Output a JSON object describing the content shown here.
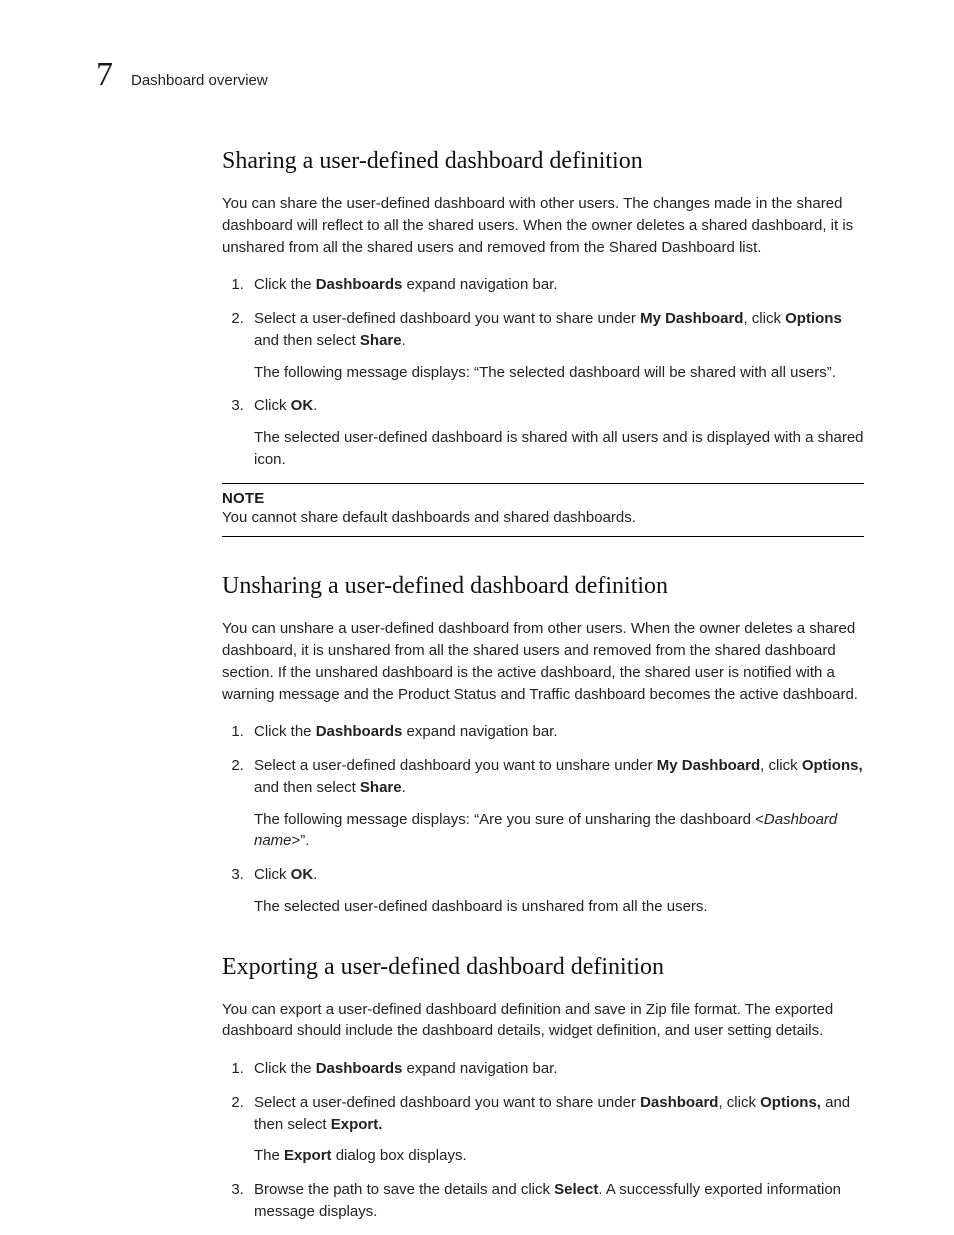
{
  "header": {
    "chapter_num": "7",
    "chapter_title": "Dashboard overview"
  },
  "sections": {
    "sharing": {
      "title": "Sharing a user-defined dashboard definition",
      "intro": "You can share the user-defined dashboard with other users. The changes made in the shared dashboard will reflect to all the shared users. When the owner deletes a shared dashboard, it is unshared from all the shared users and removed from the Shared Dashboard list.",
      "step1_a": "Click the ",
      "step1_b": "Dashboards",
      "step1_c": " expand navigation bar.",
      "step2_a": "Select a user-defined dashboard you want to share under ",
      "step2_b": "My Dashboard",
      "step2_c": ", click ",
      "step2_d": "Options",
      "step2_e": " and then select ",
      "step2_f": "Share",
      "step2_g": ".",
      "step2_sub": "The following message displays: “The selected dashboard will be shared with all users”.",
      "step3_a": "Click ",
      "step3_b": "OK",
      "step3_c": ".",
      "step3_sub": "The selected user-defined dashboard is shared with all users and is displayed with a shared icon.",
      "note_label": "NOTE",
      "note_text": "You cannot share default dashboards and shared dashboards."
    },
    "unsharing": {
      "title": "Unsharing a user-defined dashboard definition",
      "intro": "You can unshare a user-defined dashboard from other users. When the owner deletes a shared dashboard, it is unshared from all the shared users and removed from the shared dashboard section. If the unshared dashboard is the active dashboard, the shared user is notified with a warning message and the Product Status and Traffic dashboard becomes the active dashboard.",
      "step1_a": "Click the ",
      "step1_b": "Dashboards",
      "step1_c": " expand navigation bar.",
      "step2_a": "Select a user-defined dashboard you want to unshare under ",
      "step2_b": "My Dashboard",
      "step2_c": ", click ",
      "step2_d": "Options,",
      "step2_e": " and then select ",
      "step2_f": "Share",
      "step2_g": ".",
      "step2_sub_a": "The following message displays: “Are you sure of unsharing the dashboard <",
      "step2_sub_b": "Dashboard name",
      "step2_sub_c": ">”.",
      "step3_a": "Click ",
      "step3_b": "OK",
      "step3_c": ".",
      "step3_sub": "The selected user-defined dashboard is unshared from all the users."
    },
    "exporting": {
      "title": "Exporting a user-defined dashboard definition",
      "intro": "You can export a user-defined dashboard definition and save in Zip file format. The exported dashboard should include the dashboard details, widget definition, and user setting details.",
      "step1_a": "Click the ",
      "step1_b": "Dashboards",
      "step1_c": " expand navigation bar.",
      "step2_a": "Select a user-defined dashboard you want to share under ",
      "step2_b": "Dashboard",
      "step2_c": ", click ",
      "step2_d": "Options,",
      "step2_e": " and then select ",
      "step2_f": "Export.",
      "step2_sub_a": "The ",
      "step2_sub_b": "Export",
      "step2_sub_c": " dialog box displays.",
      "step3_a": "Browse the path to save the details and click ",
      "step3_b": "Select",
      "step3_c": ". A successfully exported information message displays."
    }
  }
}
